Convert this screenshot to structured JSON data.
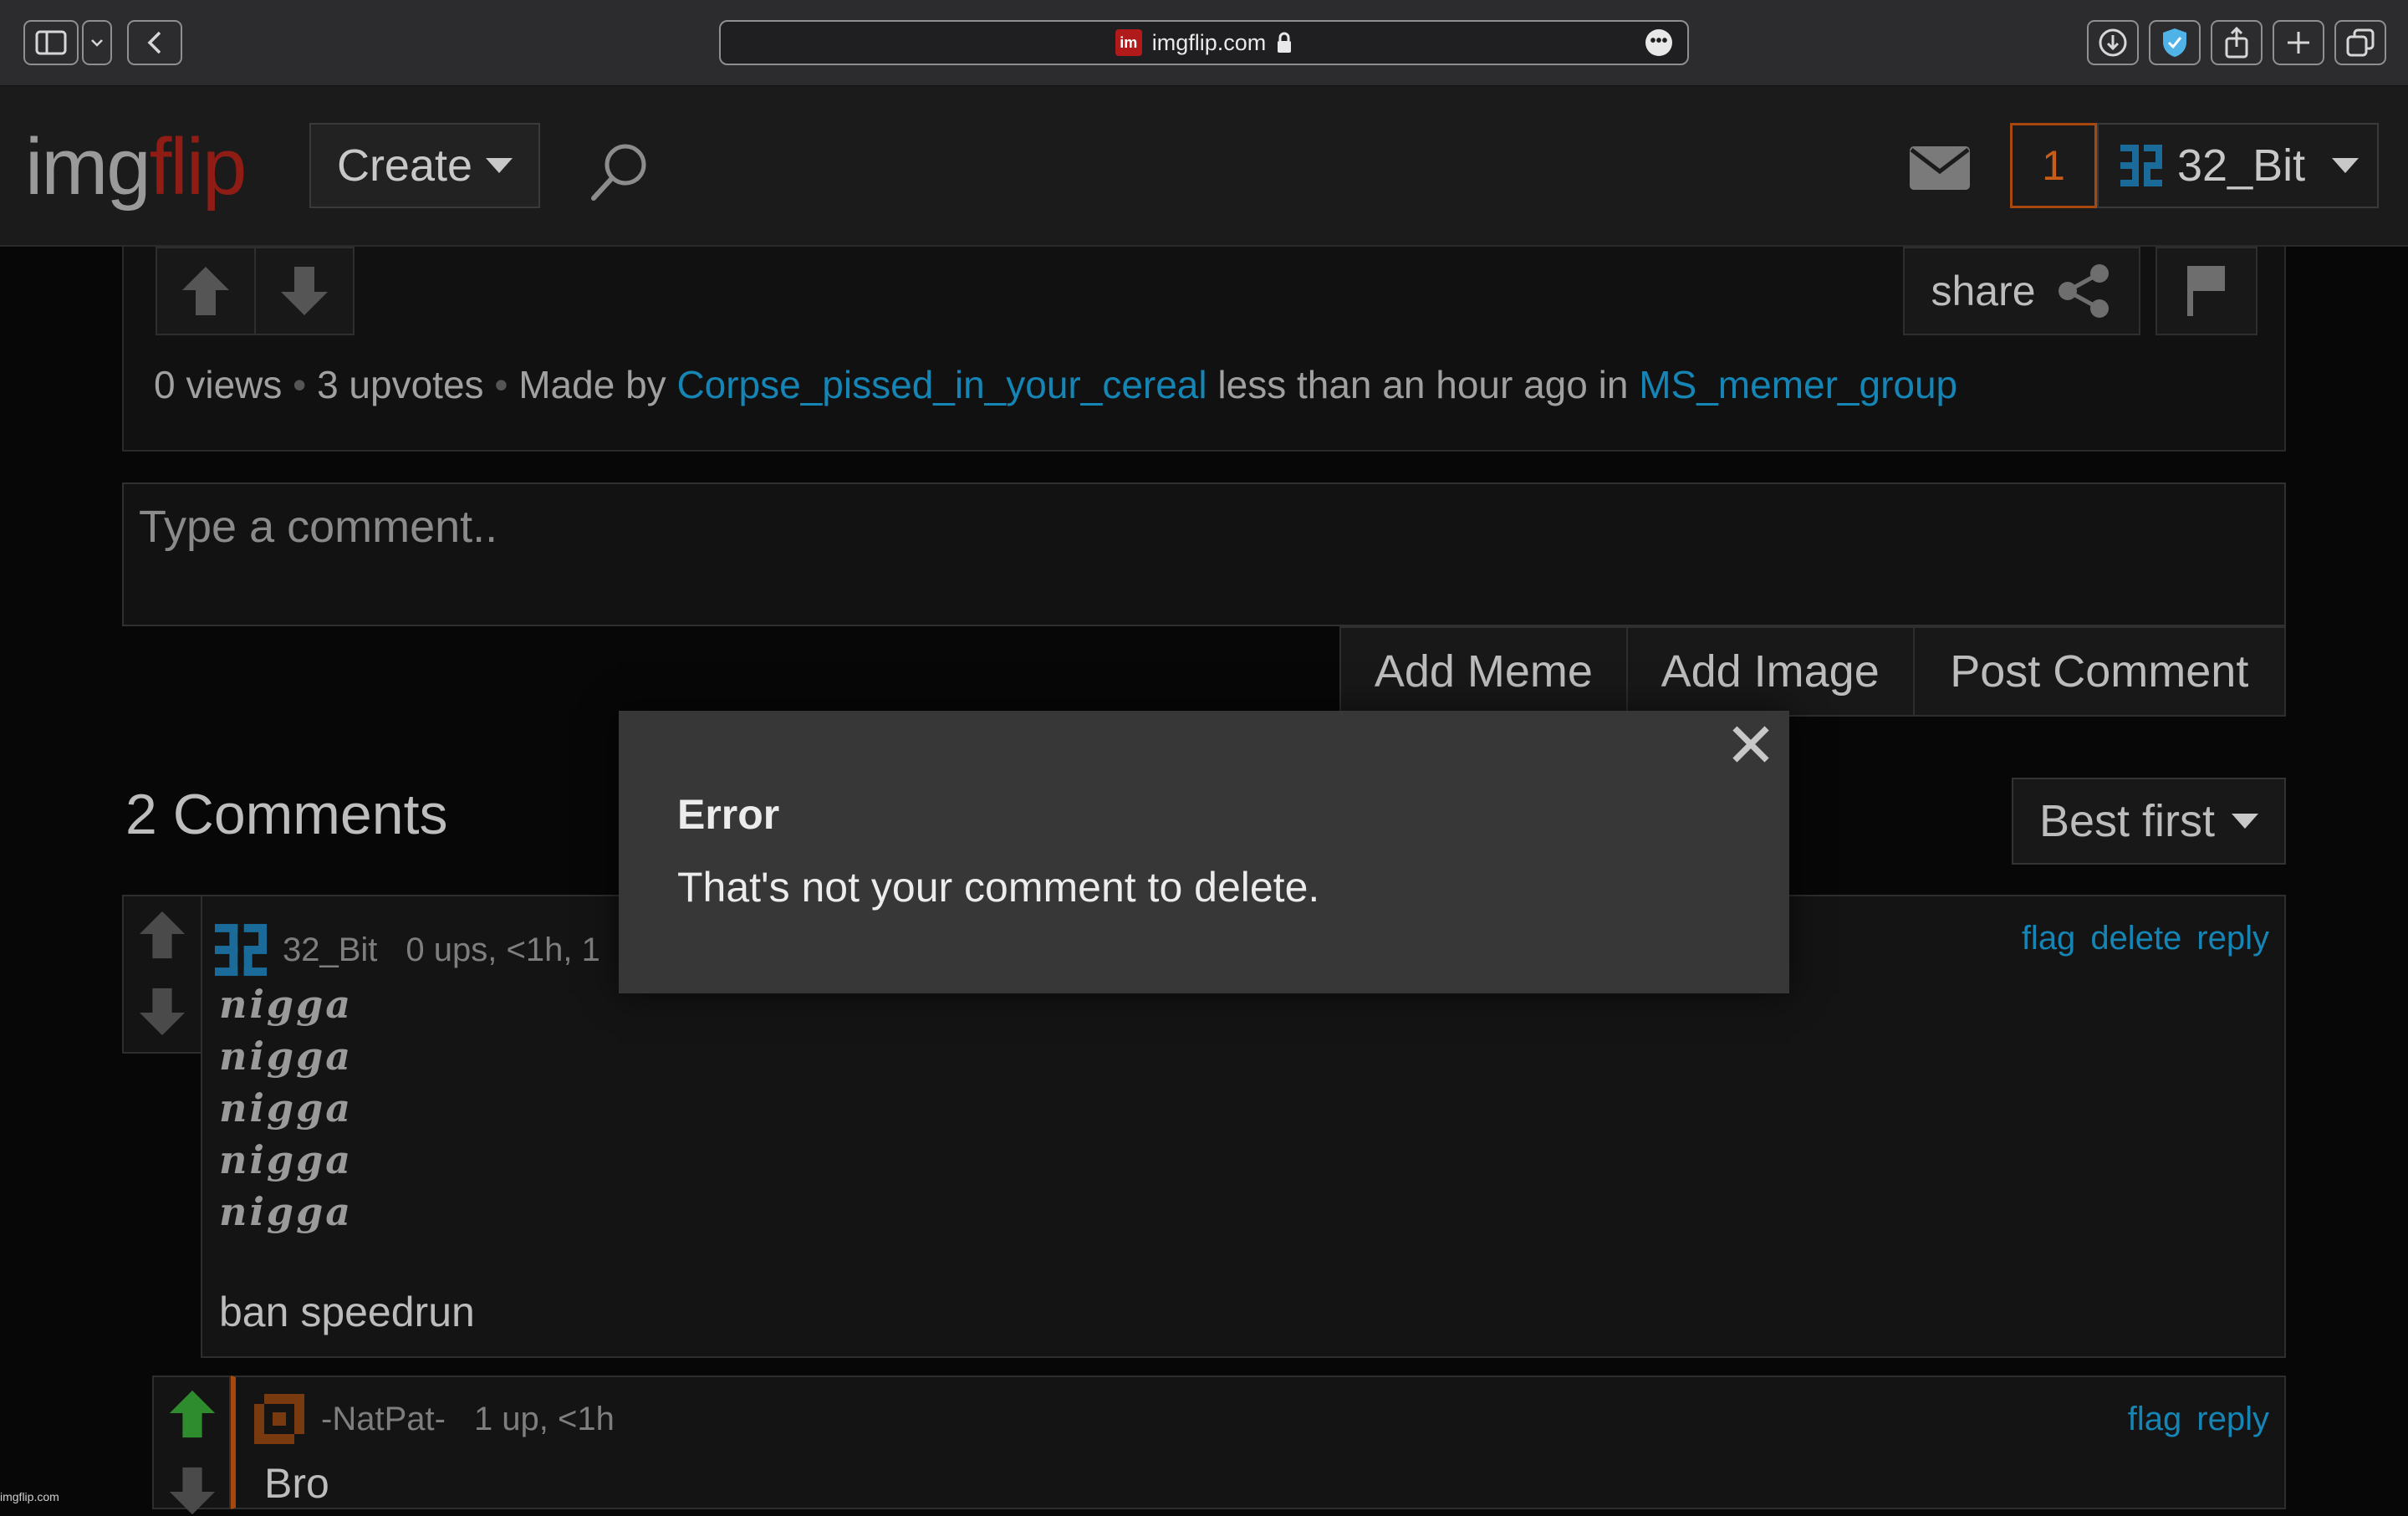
{
  "browser": {
    "domain": "imgflip.com",
    "favicon_text": "im",
    "more_glyph": "•••"
  },
  "header": {
    "logo_part1": "img",
    "logo_part2": "flip",
    "create_label": "Create",
    "notification_count": "1",
    "username": "32_Bit"
  },
  "meme": {
    "share_label": "share",
    "views": "0 views",
    "upvotes": "3 upvotes",
    "made_by_label": "Made by",
    "author": "Corpse_pissed_in_your_cereal",
    "time": "less than an hour ago in",
    "group": "MS_memer_group"
  },
  "comment_form": {
    "placeholder": "Type a comment..",
    "add_meme": "Add Meme",
    "add_image": "Add Image",
    "post_comment": "Post Comment"
  },
  "comments": {
    "title": "2 Comments",
    "sort": "Best first",
    "items": [
      {
        "user": "32_Bit",
        "meta": "0 ups, <1h, 1",
        "flag": "flag",
        "delete": "delete",
        "reply": "reply",
        "lines": [
          "nigga",
          "nigga",
          "nigga",
          "nigga",
          "nigga"
        ],
        "text": "ban speedrun"
      },
      {
        "user": "-NatPat-",
        "meta": "1 up, <1h",
        "flag": "flag",
        "reply": "reply",
        "text": "Bro"
      }
    ]
  },
  "modal": {
    "title": "Error",
    "message": "That's not your comment to delete.",
    "close_glyph": "✕"
  },
  "watermark": "imgflip.com",
  "colors": {
    "accent_link": "#1585b5",
    "brand_red": "#8f1c15",
    "notif_orange": "#c75d16",
    "upvote_green": "#2e8b2e"
  }
}
